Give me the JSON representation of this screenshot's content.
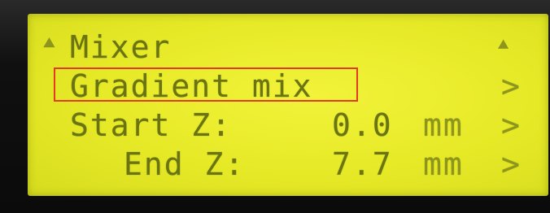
{
  "screen": {
    "title": "Mixer",
    "back_icon": "up-arrow-icon",
    "corner_icon": "up-arrow-icon"
  },
  "menu_items": [
    {
      "label": "Gradient mix",
      "value": "",
      "unit": "",
      "arrow": ">"
    },
    {
      "label": "Start Z:",
      "value": "0.0",
      "unit": "mm",
      "arrow": ">"
    },
    {
      "label": "End Z:",
      "value": "7.7",
      "unit": "mm",
      "arrow": ">"
    }
  ],
  "highlight_color": "#e23b24"
}
